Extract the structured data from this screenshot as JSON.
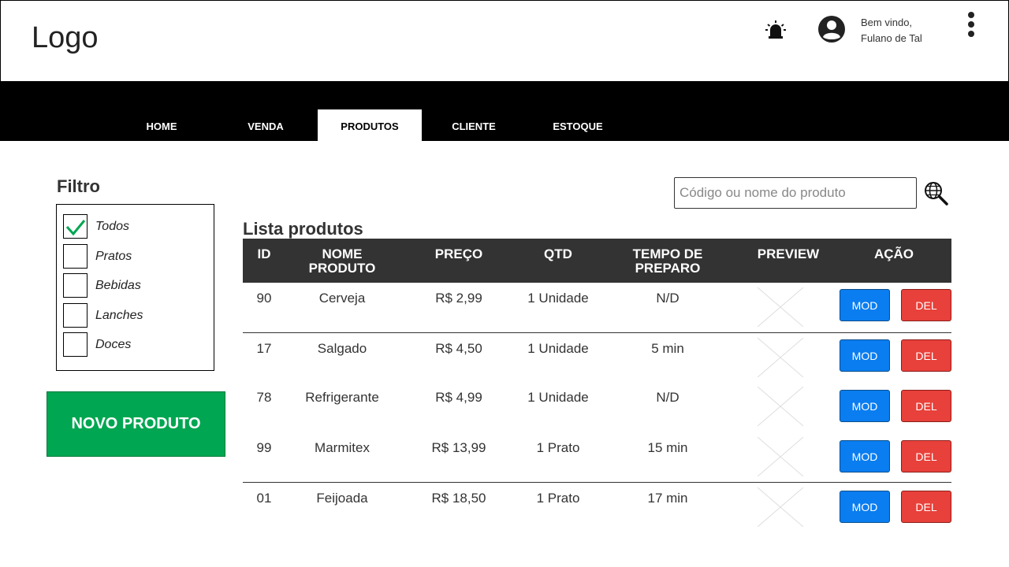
{
  "header": {
    "logo": "Logo",
    "welcome_line1": "Bem vindo,",
    "welcome_line2": "Fulano de Tal",
    "alarm_icon": "alarm-icon",
    "avatar_icon": "account-circle-icon",
    "menu_icon": "kebab-menu-icon"
  },
  "nav": {
    "tabs": [
      {
        "label": "HOME",
        "active": false
      },
      {
        "label": "VENDA",
        "active": false
      },
      {
        "label": "PRODUTOS",
        "active": true
      },
      {
        "label": "CLIENTE",
        "active": false
      },
      {
        "label": "ESTOQUE",
        "active": false
      }
    ]
  },
  "filter": {
    "title": "Filtro",
    "options": [
      {
        "label": "Todos",
        "checked": true
      },
      {
        "label": "Pratos",
        "checked": false
      },
      {
        "label": "Bebidas",
        "checked": false
      },
      {
        "label": "Lanches",
        "checked": false
      },
      {
        "label": "Doces",
        "checked": false
      }
    ]
  },
  "new_product_label": "NOVO PRODUTO",
  "search": {
    "placeholder": "Código ou nome do produto",
    "icon": "globe-search-icon"
  },
  "list": {
    "title": "Lista produtos",
    "columns": [
      "ID",
      "NOME\nPRODUTO",
      "PREÇO",
      "QTD",
      "TEMPO DE\nPREPARO",
      "PREVIEW",
      "AÇÃO"
    ],
    "rows": [
      {
        "id": "90",
        "name": "Cerveja",
        "price": "R$ 2,99",
        "qty": "1 Unidade",
        "time": "N/D"
      },
      {
        "id": "17",
        "name": "Salgado",
        "price": "R$ 4,50",
        "qty": "1 Unidade",
        "time": "5 min"
      },
      {
        "id": "78",
        "name": "Refrigerante",
        "price": "R$ 4,99",
        "qty": "1 Unidade",
        "time": "N/D"
      },
      {
        "id": "99",
        "name": "Marmitex",
        "price": "R$ 13,99",
        "qty": "1 Prato",
        "time": "15 min"
      },
      {
        "id": "01",
        "name": "Feijoada",
        "price": "R$ 18,50",
        "qty": "1 Prato",
        "time": "17 min"
      }
    ],
    "mod_label": "MOD",
    "del_label": "DEL"
  },
  "colors": {
    "green": "#00a651",
    "blue": "#0a7df0",
    "red": "#e8403a",
    "header_bg": "#333333"
  }
}
